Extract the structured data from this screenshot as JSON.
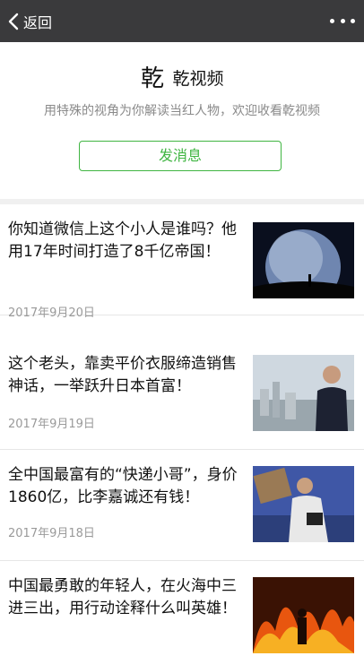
{
  "topbar": {
    "back_label": "返回",
    "more_icon": "more-dots-icon"
  },
  "profile": {
    "name": "乾视频",
    "description": "用特殊的视角为你解读当红人物，欢迎收看乾视频",
    "message_button": "发消息",
    "accent_color": "#40b542"
  },
  "articles": [
    {
      "title": "你知道微信上这个小人是谁吗？他用17年时间打造了8千亿帝国！",
      "date": "2017年9月20日"
    },
    {
      "title": "这个老头，靠卖平价衣服缔造销售神话，一举跃升日本首富！",
      "date": "2017年9月19日"
    },
    {
      "title": "全中国最富有的“快递小哥”，身价1860亿，比李嘉诚还有钱！",
      "date": "2017年9月18日"
    },
    {
      "title": "中国最勇敢的年轻人，在火海中三进三出，用行动诠释什么叫英雄！",
      "date": ""
    }
  ]
}
